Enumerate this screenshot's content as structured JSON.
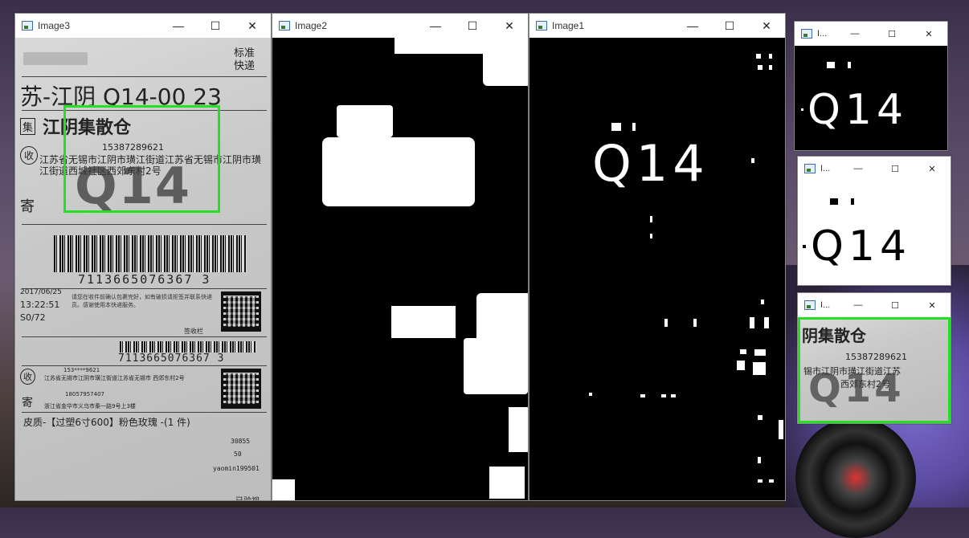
{
  "windows": {
    "image3": {
      "title": "Image3"
    },
    "image2": {
      "title": "Image2"
    },
    "image1": {
      "title": "Image1"
    },
    "small1": {
      "title": "I..."
    },
    "small2": {
      "title": "I..."
    },
    "small3": {
      "title": "I..."
    }
  },
  "controls": {
    "minimize": "—",
    "maximize": "☐",
    "close": "✕"
  },
  "label": {
    "service_type": "标准\n快递",
    "route": "苏-江阴 Q14-00 23",
    "station": "江阴集散仓",
    "phone": "15387289621",
    "address": "江苏省无锡市江阴市璜江街道江苏省无锡市江阴市璜江街道西城社区西郊东村2号",
    "big_code": "Q14",
    "barcode_number": "7113665076367 3",
    "date": "2017/06/25",
    "time": "13:22:51",
    "ratio": "S0/72",
    "notice": "请您在收件前确认包裹完好，如有破损请拒签并联系快递员。感谢使用本快递服务。",
    "signature": "签收栏",
    "barcode_number_2": "7113665076367 3",
    "sender_phone": "153****9621",
    "sender_addr": "江苏省无锡市江阴市璜江街道江苏省无锡市 西郊东村2号",
    "recv_phone": "18057957407",
    "recv_addr": "浙江省金华市义乌市秦一路9号上3楼",
    "product": "皮质-【过塑6寸600】粉色玫瑰 -(1 件)",
    "weight": "30855",
    "qty": "50",
    "user": "yaomin199501",
    "inspected": "已验视",
    "icon_send": "集",
    "icon_recv": "收",
    "icon_post": "寄"
  },
  "binary": {
    "code_white": "Q14",
    "code_black": "Q14"
  },
  "crop": {
    "line1": "阴集散仓",
    "line2": "15387289621",
    "line3": "锡市江阴市璜江街道江苏",
    "line4": "西郊东村2号",
    "code": "Q14"
  }
}
